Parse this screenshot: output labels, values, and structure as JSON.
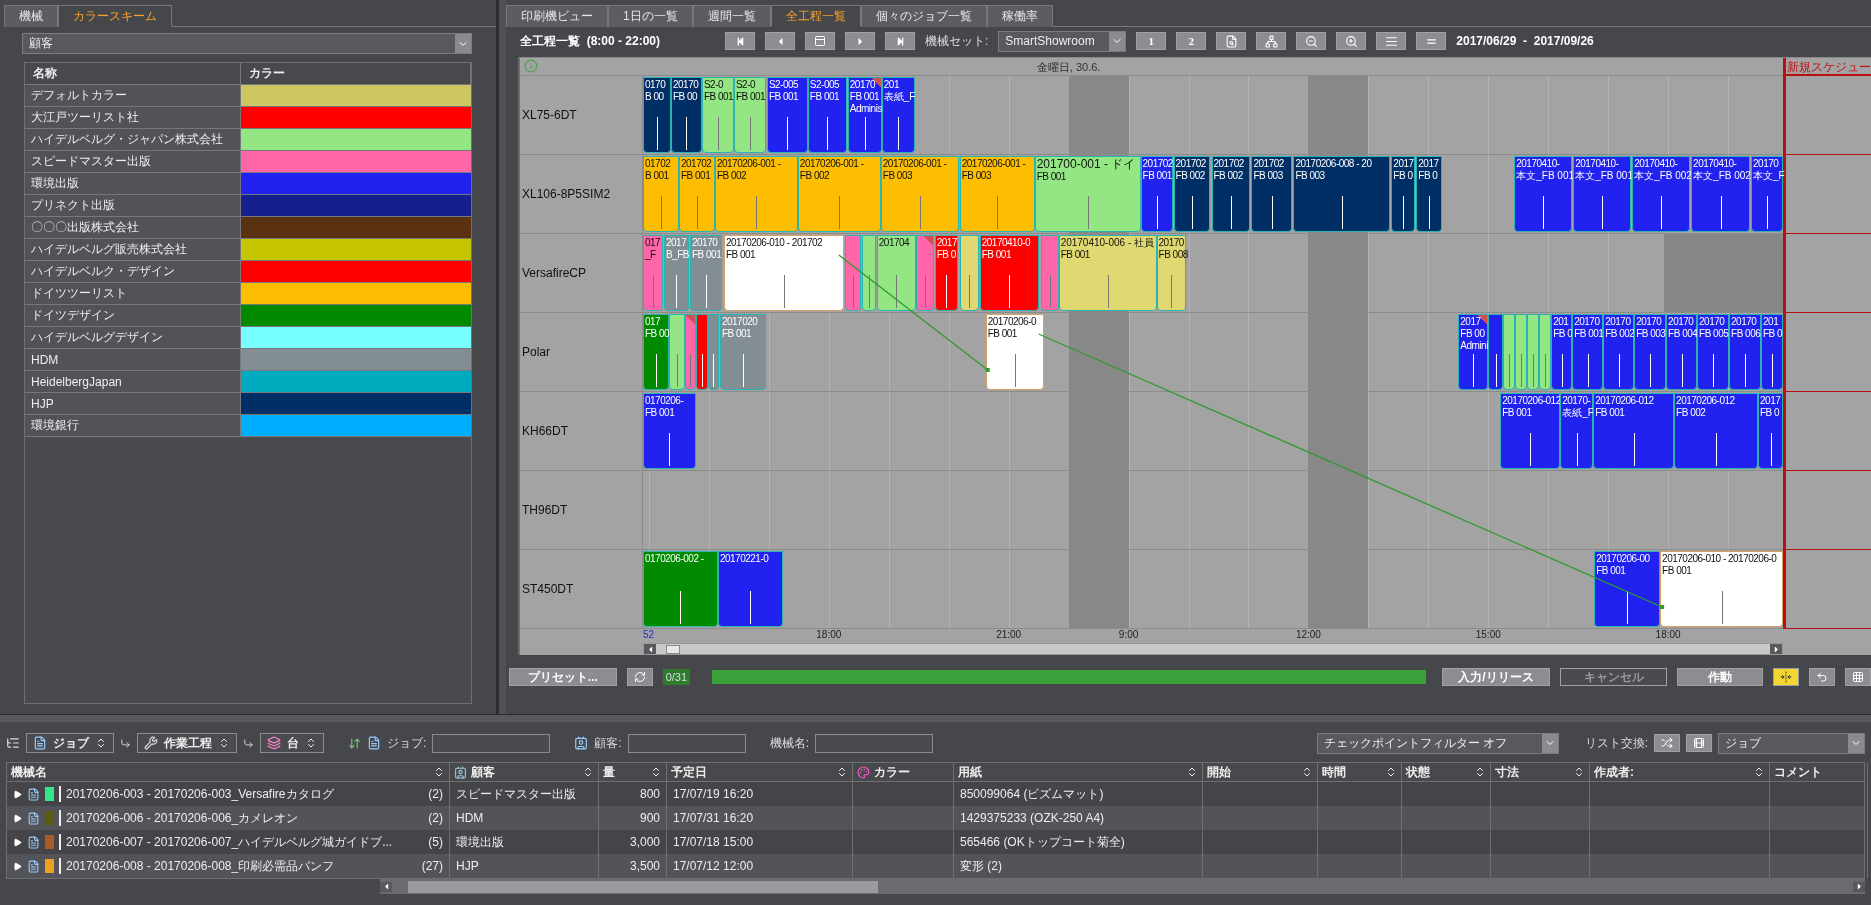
{
  "left_panel": {
    "tabs": [
      {
        "label": "機械",
        "selected": false
      },
      {
        "label": "カラースキーム",
        "selected": true
      }
    ],
    "scheme_select": {
      "value": "顧客"
    },
    "color_table": {
      "columns": [
        "名称",
        "カラー"
      ],
      "rows": [
        {
          "name": "デフォルトカラー",
          "color": "#cdc663"
        },
        {
          "name": "大江戸ツーリスト社",
          "color": "#ff0000"
        },
        {
          "name": "ハイデルベルグ・ジャパン株式会社",
          "color": "#93e683"
        },
        {
          "name": "スピードマスター出版",
          "color": "#ff66aa"
        },
        {
          "name": "環境出版",
          "color": "#2121f0"
        },
        {
          "name": "プリネクト出版",
          "color": "#161f8e"
        },
        {
          "name": "〇〇〇出版株式会社",
          "color": "#5a3212"
        },
        {
          "name": "ハイデルベルグ販売株式会社",
          "color": "#c6c600"
        },
        {
          "name": "ハイデルベルク・デザイン",
          "color": "#ff0000"
        },
        {
          "name": "ドイツツーリスト",
          "color": "#fdbd00"
        },
        {
          "name": "ドイツデザイン",
          "color": "#008a00"
        },
        {
          "name": "ハイデルベルグデザイン",
          "color": "#77ffff"
        },
        {
          "name": "HDM",
          "color": "#838d94"
        },
        {
          "name": "HeidelbergJapan",
          "color": "#00aabe"
        },
        {
          "name": "HJP",
          "color": "#002f65"
        },
        {
          "name": "環境銀行",
          "color": "#00aeff"
        }
      ]
    }
  },
  "view_tabs": [
    {
      "label": "印刷機ビュー",
      "selected": false
    },
    {
      "label": "1日の一覧",
      "selected": false
    },
    {
      "label": "週間一覧",
      "selected": false
    },
    {
      "label": "全工程一覧",
      "selected": true
    },
    {
      "label": "個々のジョブ一覧",
      "selected": false
    },
    {
      "label": "稼働率",
      "selected": false
    }
  ],
  "toolbar": {
    "title": "全工程一覧  (8:00 - 22:00)",
    "machine_set_label": "機械セット:",
    "machine_set": "SmartShowroom",
    "pages": [
      "1",
      "2"
    ],
    "date_range": "2017/06/29  -  2017/09/26"
  },
  "chart": {
    "new_schedule": "新規スケジュー",
    "day_labels": [
      "金曜日, 30.6."
    ],
    "axis_labels": [
      {
        "text": "52",
        "kind": "week"
      },
      {
        "text": "18:00",
        "kind": "time"
      },
      {
        "text": "21:00",
        "kind": "time"
      },
      {
        "text": "9:00",
        "kind": "time"
      },
      {
        "text": "12:00",
        "kind": "time"
      },
      {
        "text": "15:00",
        "kind": "time"
      },
      {
        "text": "18:00",
        "kind": "time"
      }
    ],
    "rows": [
      {
        "machine": "XL75-6DT",
        "jobs": [
          {
            "color": "#002f65",
            "lines": [
              "0170",
              "B 00"
            ],
            "flag": false,
            "linked": false
          },
          {
            "color": "#002f65",
            "lines": [
              "20170",
              "FB 00"
            ],
            "flag": false,
            "linked": false
          },
          {
            "color": "#93e683",
            "lines": [
              "S2-0",
              "FB 001"
            ],
            "flag": false,
            "linked": false
          },
          {
            "color": "#93e683",
            "lines": [
              "S2-0",
              "FB 001"
            ],
            "flag": false,
            "linked": false
          },
          {
            "color": "#2121f0",
            "lines": [
              "S2-005",
              "FB 001"
            ],
            "flag": false,
            "linked": false
          },
          {
            "color": "#2121f0",
            "lines": [
              "S2-005",
              "FB 001"
            ],
            "flag": false,
            "linked": false
          },
          {
            "color": "#2121f0",
            "lines": [
              "20170",
              "FB 001",
              "Adminis"
            ],
            "flag": true,
            "linked": false
          },
          {
            "color": "#2121f0",
            "lines": [
              "201",
              "表紙_F"
            ],
            "flag": false,
            "linked": false
          }
        ]
      },
      {
        "machine": "XL106-8P5SIM2",
        "jobs": [
          {
            "color": "#fdbd00",
            "lines": [
              "01702",
              "B 001"
            ],
            "flag": false,
            "linked": false
          },
          {
            "color": "#fdbd00",
            "lines": [
              "201702",
              "FB 001"
            ],
            "flag": false,
            "linked": false
          },
          {
            "color": "#fdbd00",
            "lines": [
              "20170206-001 -",
              "FB 002"
            ],
            "flag": false,
            "linked": false
          },
          {
            "color": "#fdbd00",
            "lines": [
              "20170206-001 -",
              "FB 002"
            ],
            "flag": false,
            "linked": false
          },
          {
            "color": "#fdbd00",
            "lines": [
              "20170206-001 -",
              "FB 003"
            ],
            "flag": false,
            "linked": false
          },
          {
            "color": "#fdbd00",
            "lines": [
              "20170206-001 -",
              "FB 003"
            ],
            "flag": false,
            "linked": false
          },
          {
            "color": "#93e683",
            "lines": [
              "201700-001 - ドイ",
              "FB 001"
            ],
            "flag": false,
            "linked": false
          },
          {
            "color": "#2121f0",
            "lines": [
              "201702",
              "FB 001"
            ],
            "flag": false,
            "linked": false
          },
          {
            "color": "#002f65",
            "lines": [
              "201702",
              "FB 002"
            ],
            "flag": false,
            "linked": false
          },
          {
            "color": "#002f65",
            "lines": [
              "201702",
              "FB 002"
            ],
            "flag": false,
            "linked": false
          },
          {
            "color": "#002f65",
            "lines": [
              "201702",
              "FB 003"
            ],
            "flag": false,
            "linked": false
          },
          {
            "color": "#002f65",
            "lines": [
              "20170206-008 - 20",
              "FB 003"
            ],
            "flag": false,
            "linked": false
          },
          {
            "color": "#002f65",
            "lines": [
              "2017",
              "FB 0"
            ],
            "flag": false,
            "linked": false
          },
          {
            "color": "#002f65",
            "lines": [
              "2017",
              "FB 0"
            ],
            "flag": false,
            "linked": false
          },
          {
            "color": "#2121f0",
            "lines": [
              "20170410-",
              "本文_FB 001"
            ],
            "flag": false,
            "linked": false
          },
          {
            "color": "#2121f0",
            "lines": [
              "20170410-",
              "本文_FB 001"
            ],
            "flag": false,
            "linked": false
          },
          {
            "color": "#2121f0",
            "lines": [
              "20170410-",
              "本文_FB 002"
            ],
            "flag": false,
            "linked": false
          },
          {
            "color": "#2121f0",
            "lines": [
              "20170410-",
              "本文_FB 002"
            ],
            "flag": false,
            "linked": false
          },
          {
            "color": "#2121f0",
            "lines": [
              "20170",
              "本文_F"
            ],
            "flag": false,
            "linked": false
          }
        ]
      },
      {
        "machine": "VersafireCP",
        "jobs": [
          {
            "color": "#ff66aa",
            "lines": [
              "017",
              "_F"
            ],
            "flag": false,
            "linked": false
          },
          {
            "color": "#838d94",
            "lines": [
              "2017",
              "B_FB"
            ],
            "flag": false,
            "linked": false
          },
          {
            "color": "#838d94",
            "lines": [
              "20170",
              "FB 001"
            ],
            "flag": false,
            "linked": false
          },
          {
            "color": "#ffffff",
            "lines": [
              "20170206-010 - 201702",
              "FB 001"
            ],
            "flag": false,
            "linked": true
          },
          {
            "color": "#ff66aa",
            "flag": false,
            "linked": false
          },
          {
            "color": "#93e683",
            "flag": false,
            "linked": false
          },
          {
            "color": "#93e683",
            "lines": [
              "201704"
            ],
            "flag": false,
            "linked": false
          },
          {
            "color": "#ff66aa",
            "flag": true,
            "linked": false
          },
          {
            "color": "#ff0000",
            "lines": [
              "2017",
              "FB 0"
            ],
            "flag": false,
            "linked": false
          },
          {
            "color": "#e0d870",
            "flag": false,
            "linked": false
          },
          {
            "color": "#ff0000",
            "lines": [
              "20170410-0",
              "FB 001"
            ],
            "flag": false,
            "linked": false
          },
          {
            "color": "#ff66aa",
            "flag": false,
            "linked": false
          },
          {
            "color": "#e0d870",
            "lines": [
              "20170410-006 - 社員",
              "FB 001"
            ],
            "flag": false,
            "linked": false
          },
          {
            "color": "#e0d870",
            "lines": [
              "20170",
              "FB 008"
            ],
            "flag": false,
            "linked": false
          }
        ]
      },
      {
        "machine": "Polar",
        "jobs": [
          {
            "color": "#008a00",
            "lines": [
              "017",
              "FB 00"
            ],
            "flag": false,
            "linked": false
          },
          {
            "color": "#93e683",
            "flag": false,
            "linked": false
          },
          {
            "color": "#ff66aa",
            "flag": true,
            "linked": false
          },
          {
            "color": "#ff0000",
            "flag": false,
            "linked": false
          },
          {
            "color": "#838d94",
            "flag": false,
            "linked": false
          },
          {
            "color": "#838d94",
            "lines": [
              "2017020",
              "FB 001"
            ],
            "flag": false,
            "linked": false
          },
          {
            "color": "#ffffff",
            "lines": [
              "20170206-0",
              "FB 001"
            ],
            "flag": false,
            "linked": true
          },
          {
            "color": "#2121f0",
            "lines": [
              "2017",
              "FB 00",
              "Admini"
            ],
            "flag": true,
            "linked": false
          },
          {
            "color": "#2121f0",
            "flag": false,
            "linked": false
          },
          {
            "color": "#93e683",
            "flag": false,
            "linked": false
          },
          {
            "color": "#93e683",
            "flag": false,
            "linked": false
          },
          {
            "color": "#93e683",
            "flag": false,
            "linked": false
          },
          {
            "color": "#93e683",
            "flag": false,
            "linked": false
          },
          {
            "color": "#2121f0",
            "lines": [
              "201",
              "FB 0"
            ],
            "flag": false,
            "linked": false
          },
          {
            "color": "#2121f0",
            "lines": [
              "20170",
              "FB 001"
            ],
            "flag": false,
            "linked": false
          },
          {
            "color": "#2121f0",
            "lines": [
              "20170",
              "FB 002"
            ],
            "flag": false,
            "linked": false
          },
          {
            "color": "#2121f0",
            "lines": [
              "20170",
              "FB 003"
            ],
            "flag": false,
            "linked": false
          },
          {
            "color": "#2121f0",
            "lines": [
              "20170",
              "FB 004"
            ],
            "flag": false,
            "linked": false
          },
          {
            "color": "#2121f0",
            "lines": [
              "20170",
              "FB 005"
            ],
            "flag": false,
            "linked": false
          },
          {
            "color": "#2121f0",
            "lines": [
              "20170",
              "FB 006"
            ],
            "flag": false,
            "linked": false
          },
          {
            "color": "#2121f0",
            "lines": [
              "201",
              "FB 0"
            ],
            "flag": false,
            "linked": false
          }
        ]
      },
      {
        "machine": "KH66DT",
        "jobs": [
          {
            "color": "#2121f0",
            "lines": [
              "0170206-",
              "FB 001"
            ],
            "flag": false,
            "linked": false
          },
          {
            "color": "#2121f0",
            "lines": [
              "20170206-012",
              "FB 001"
            ],
            "flag": false,
            "linked": false
          },
          {
            "color": "#2121f0",
            "lines": [
              "20170-",
              "表紙_F"
            ],
            "flag": false,
            "linked": false
          },
          {
            "color": "#2121f0",
            "lines": [
              "20170206-012",
              "FB 001"
            ],
            "flag": false,
            "linked": false
          },
          {
            "color": "#2121f0",
            "lines": [
              "20170206-012",
              "FB 002"
            ],
            "flag": false,
            "linked": false
          },
          {
            "color": "#2121f0",
            "lines": [
              "2017",
              "FB 0"
            ],
            "flag": false,
            "linked": false
          }
        ]
      },
      {
        "machine": "TH96DT"
      },
      {
        "machine": "ST450DT",
        "jobs": [
          {
            "color": "#008a00",
            "lines": [
              "0170206-002 -"
            ],
            "flag": false,
            "linked": false
          },
          {
            "color": "#2121f0",
            "lines": [
              "20170221-0"
            ],
            "flag": false,
            "linked": false
          },
          {
            "color": "#2121f0",
            "lines": [
              "20170206-00",
              "FB 001"
            ],
            "flag": false,
            "linked": false
          },
          {
            "color": "#ffffff",
            "lines": [
              "20170206-010 - 20170206-0",
              "FB 001"
            ],
            "flag": false,
            "linked": true
          }
        ]
      }
    ]
  },
  "action_bar": {
    "preset": "プリセット...",
    "counter": "0/31",
    "progress": {
      "level": 1
    },
    "buttons": [
      {
        "label": "入力/リリース",
        "disabled": false
      },
      {
        "label": "キャンセル",
        "disabled": true
      },
      {
        "label": "作動",
        "disabled": false
      }
    ]
  },
  "job_list": {
    "group_chips": [
      "ジョブ",
      "作業工程",
      "台"
    ],
    "filters": [
      {
        "label": "ジョブ:",
        "kind": "job"
      },
      {
        "label": "顧客:",
        "kind": "customer"
      },
      {
        "label": "機械名:",
        "kind": "plain"
      }
    ],
    "checkpoint_filter": "チェックポイントフィルター オフ",
    "list_exchange_label": "リスト交換:",
    "view_select": "ジョブ",
    "columns": [
      {
        "label": "機械名",
        "kind": "plain",
        "sortable": true
      },
      {
        "label": "顧客",
        "kind": "customer",
        "sortable": true
      },
      {
        "label": "量",
        "kind": "plain",
        "sortable": true
      },
      {
        "label": "予定日",
        "kind": "plain",
        "sortable": true
      },
      {
        "label": "カラー",
        "kind": "color",
        "sortable": false
      },
      {
        "label": "用紙",
        "kind": "plain",
        "sortable": true
      },
      {
        "label": "開始",
        "kind": "plain",
        "sortable": true
      },
      {
        "label": "時間",
        "kind": "plain",
        "sortable": true
      },
      {
        "label": "状態",
        "kind": "plain",
        "sortable": true
      },
      {
        "label": "寸法",
        "kind": "plain",
        "sortable": true
      },
      {
        "label": "作成者:",
        "kind": "plain",
        "sortable": true
      },
      {
        "label": "コメント",
        "kind": "plain",
        "sortable": false
      }
    ],
    "rows": [
      {
        "expanded": false,
        "color": "#33e68a",
        "name": "20170206-003 - 20170206-003_Versafireカタログ",
        "count": "(2)",
        "customer": "スピードマスター出版",
        "quantity": "800",
        "due": "17/07/19 16:20",
        "paper": "850099064 (ビズムマット)"
      },
      {
        "expanded": false,
        "color": "#5a5a10",
        "name": "20170206-006 - 20170206-006_カメレオン",
        "count": "(2)",
        "customer": "HDM",
        "quantity": "900",
        "due": "17/07/31 16:20",
        "paper": "1429375233 (OZK-250 A4)"
      },
      {
        "expanded": false,
        "color": "#a85c2a",
        "name": "20170206-007 - 20170206-007_ハイデルベルグ城ガイドブ...",
        "count": "(5)",
        "customer": "環境出版",
        "quantity": "3,000",
        "due": "17/07/18 15:00",
        "paper": "565466 (OKトップコート菊全)"
      },
      {
        "expanded": false,
        "color": "#f0a020",
        "name": "20170206-008 - 20170206-008_印刷必需品パンフ",
        "count": "(27)",
        "customer": "HJP",
        "quantity": "3,500",
        "due": "17/07/12 12:00",
        "paper": "変形 (2)"
      }
    ]
  }
}
